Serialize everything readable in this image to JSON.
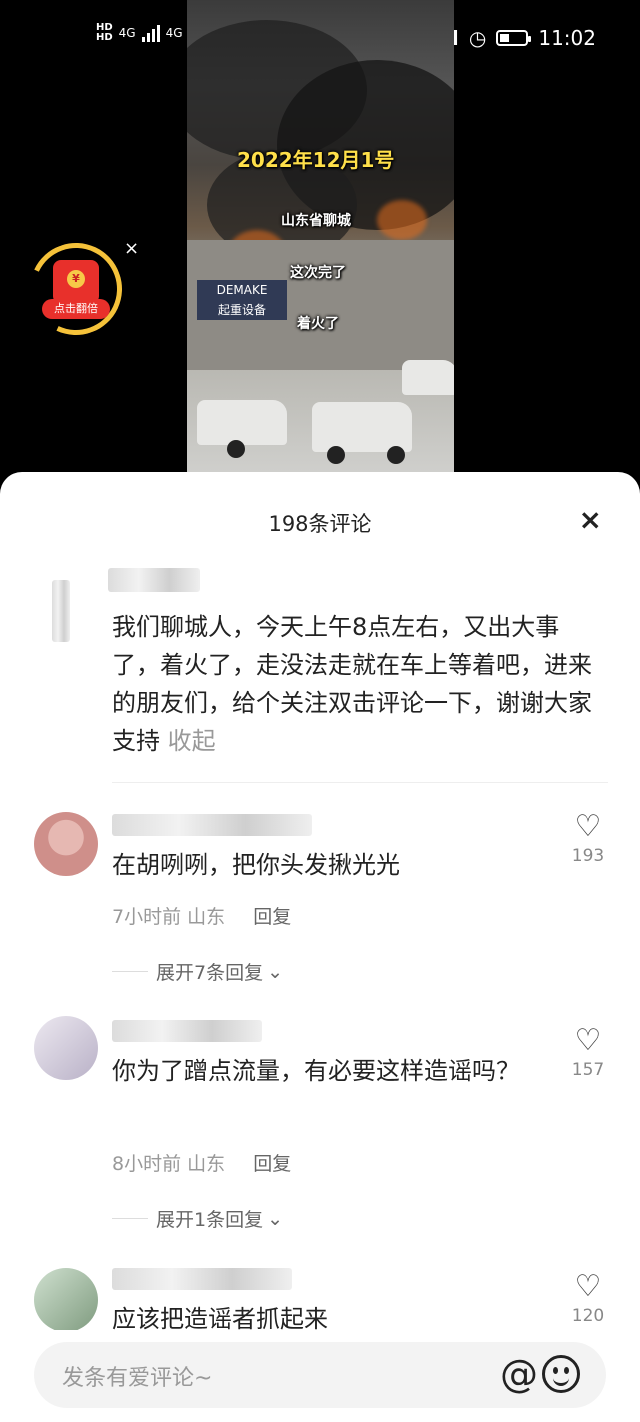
{
  "status_bar": {
    "hd1": "HD",
    "hd2": "HD",
    "net1": "4G",
    "net2": "4G",
    "time": "11:02"
  },
  "video": {
    "date_caption": "2022年12月1号",
    "caption1": "山东省聊城",
    "caption2": "这次完了",
    "caption3": "着火了",
    "sign_text": "DEMAKE",
    "sign_text2": "起重设备"
  },
  "red_packet": {
    "label": "点击翻倍",
    "coin": "¥",
    "close": "×"
  },
  "comments_panel": {
    "title": "198条评论",
    "close_icon": "×",
    "post": {
      "text": "我们聊城人，今天上午8点左右，又出大事了，着火了，走没法走就在车上等着吧，进来的朋友们，给个关注双击评论一下，谢谢大家支持",
      "collapse_label": "收起"
    },
    "comments": [
      {
        "text": "在胡咧咧，把你头发揪光光",
        "time": "7小时前",
        "location": "山东",
        "reply_label": "回复",
        "likes": "193",
        "expand_label": "展开7条回复"
      },
      {
        "text": "你为了蹭点流量，有必要这样造谣吗？",
        "time": "8小时前",
        "location": "山东",
        "reply_label": "回复",
        "likes": "157",
        "expand_label": "展开1条回复"
      },
      {
        "text": "应该把造谣者抓起来",
        "likes": "120"
      }
    ]
  },
  "composer": {
    "placeholder": "发条有爱评论~",
    "at_icon": "@"
  }
}
